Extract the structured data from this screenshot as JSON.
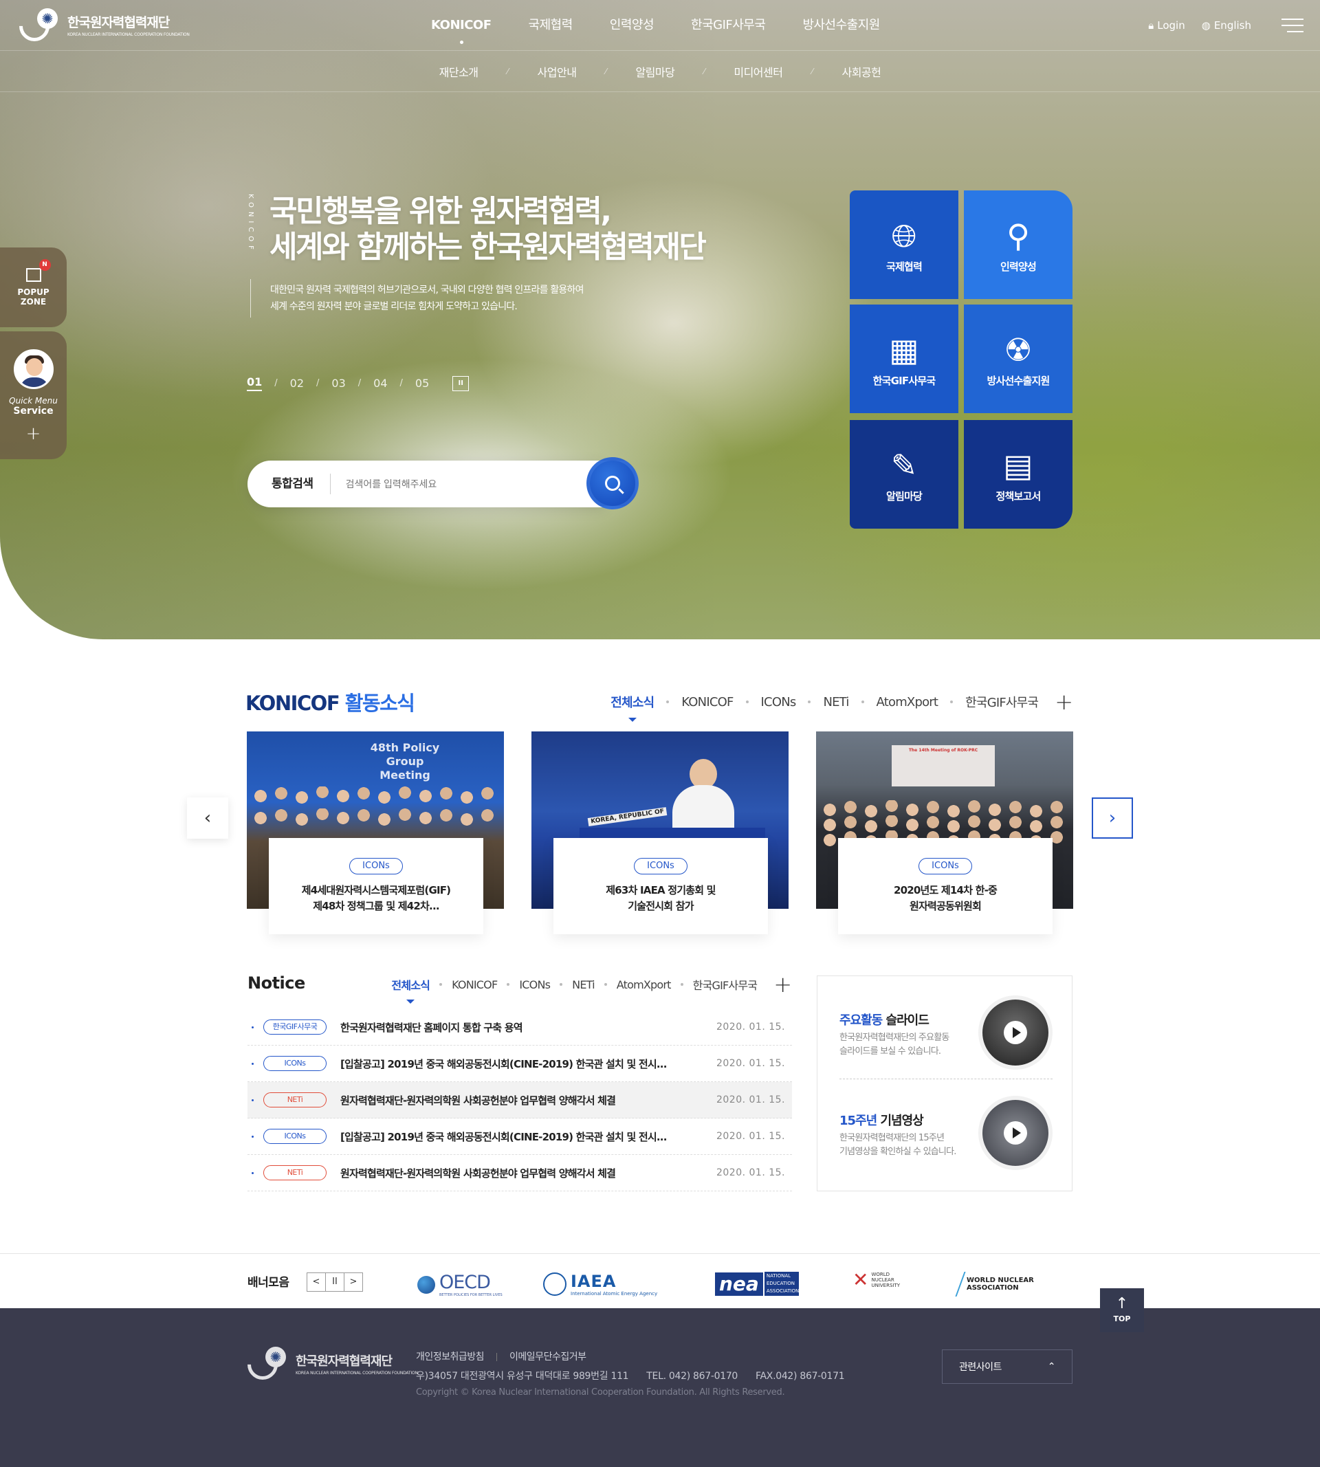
{
  "header": {
    "logo_ko": "한국원자력협력재단",
    "logo_en": "KOREA NUCLEAR INTERNATIONAL COOPERATION FOUNDATION",
    "gnb": [
      "KONICOF",
      "국제협력",
      "인력양성",
      "한국GIF사무국",
      "방사선수출지원"
    ],
    "login": "Login",
    "language": "English"
  },
  "subnav": [
    "재단소개",
    "사업안내",
    "알림마당",
    "미디어센터",
    "사회공헌"
  ],
  "side": {
    "popup_badge": "N",
    "popup_line1": "POPUP",
    "popup_line2": "ZONE",
    "quick_line1": "Quick Menu",
    "quick_line2": "Service",
    "plus": "+"
  },
  "hero": {
    "vertical_label": "KONICOF",
    "title_line1": "국민행복을 위한 원자력협력,",
    "title_line2": "세계와 함께하는 한국원자력협력재단",
    "desc_line1": "대한민국 원자력 국제협력의 허브기관으로서, 국내외 다양한 협력 인프라를 활용하여",
    "desc_line2": "세계 수준의 원자력 분야 글로벌 리더로 힘차게 도약하고 있습니다.",
    "pages": [
      "01",
      "02",
      "03",
      "04",
      "05"
    ],
    "pause": "II"
  },
  "search": {
    "label": "통합검색",
    "placeholder": "검색어를 입력해주세요"
  },
  "tiles": [
    {
      "label": "국제협력",
      "icon": "globe-person-icon"
    },
    {
      "label": "인력양성",
      "icon": "trainer-icon"
    },
    {
      "label": "한국GIF사무국",
      "icon": "building-icon"
    },
    {
      "label": "방사선수출지원",
      "icon": "radiation-icon"
    },
    {
      "label": "알림마당",
      "icon": "speech-person-icon"
    },
    {
      "label": "정책보고서",
      "icon": "presentation-icon"
    }
  ],
  "news": {
    "title_a": "KONICOF",
    "title_b": "활동소식",
    "tabs": [
      "전체소식",
      "KONICOF",
      "ICONs",
      "NETi",
      "AtomXport",
      "한국GIF사무국"
    ],
    "more": "+",
    "cards": [
      {
        "tag": "ICONs",
        "title_line1": "제4세대원자력시스템국제포럼(GIF)",
        "title_line2": "제48차 정책그룹 및 제42차...",
        "photo_text": "48th Policy Group Meeting"
      },
      {
        "tag": "ICONs",
        "title_line1": "제63차 IAEA 정기총회 및",
        "title_line2": "기술전시회 참가",
        "photo_text": "KOREA, REPUBLIC OF"
      },
      {
        "tag": "ICONs",
        "title_line1": "2020년도 제14차 한-중",
        "title_line2": "원자력공동위원회",
        "photo_text": "The 14th Meeting of ROK-PRC"
      }
    ],
    "prev": "‹",
    "next": "›"
  },
  "notice": {
    "title": "Notice",
    "tabs": [
      "전체소식",
      "KONICOF",
      "ICONs",
      "NETi",
      "AtomXport",
      "한국GIF사무국"
    ],
    "more": "+",
    "rows": [
      {
        "cat": "한국GIF사무국",
        "color": "blue",
        "text": "한국원자력협력재단 홈페이지 통합 구축 용역",
        "date": "2020. 01. 15."
      },
      {
        "cat": "ICONs",
        "color": "blue",
        "text": "[입찰공고] 2019년 중국 해외공동전시회(CINE-2019) 한국관 설치 및 전시...",
        "date": "2020. 01. 15."
      },
      {
        "cat": "NETi",
        "color": "red",
        "text": "원자력협력재단-원자력의학원 사회공헌분야 업무협력 양해각서 체결",
        "date": "2020. 01. 15."
      },
      {
        "cat": "ICONs",
        "color": "blue",
        "text": "[입찰공고] 2019년 중국 해외공동전시회(CINE-2019) 한국관 설치 및 전시...",
        "date": "2020. 01. 15."
      },
      {
        "cat": "NETi",
        "color": "red",
        "text": "원자력협력재단-원자력의학원 사회공헌분야 업무협력 양해각서 체결",
        "date": "2020. 01. 15."
      }
    ]
  },
  "media": [
    {
      "title_a": "주요활동",
      "title_b": "슬라이드",
      "desc_line1": "한국원자력협력재단의 주요활동",
      "desc_line2": "슬라이드를 보실 수 있습니다."
    },
    {
      "title_a": "15주년",
      "title_b": "기념영상",
      "desc_line1": "한국원자력협력재단의 15주년",
      "desc_line2": "기념영상을 확인하실 수 있습니다."
    }
  ],
  "banner": {
    "label": "배너모음",
    "prev": "<",
    "pause": "II",
    "next": ">",
    "oecd": "OECD",
    "oecd_sub": "BETTER POLICIES FOR BETTER LIVES",
    "iaea": "IAEA",
    "iaea_sub": "International Atomic Energy Agency",
    "nea": "nea",
    "nea_sub": "NATIONAL EDUCATION ASSOCIATION",
    "wnu": "WORLD NUCLEAR UNIVERSITY",
    "wna_line1": "WORLD NUCLEAR",
    "wna_line2": "ASSOCIATION"
  },
  "top_button": {
    "arrow": "↑",
    "label": "TOP"
  },
  "footer": {
    "logo_ko": "한국원자력협력재단",
    "logo_en": "KOREA NUCLEAR INTERNATIONAL COOPERATION FOUNDATION",
    "link1": "개인정보취급방침",
    "link2": "이메일무단수집거부",
    "address": "우)34057 대전광역시 유성구 대덕대로 989번길 111",
    "tel": "TEL. 042) 867-0170",
    "fax": "FAX.042) 867-0171",
    "copyright": "Copyright © Korea Nuclear International Cooperation Foundation. All Rights Reserved.",
    "related": "관련사이트",
    "related_arrow": "⌃"
  }
}
